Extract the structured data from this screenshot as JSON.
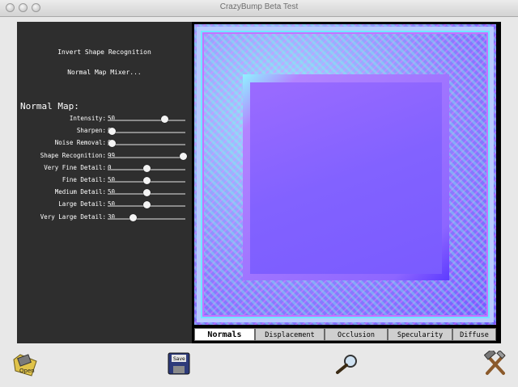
{
  "window": {
    "title": "CrazyBump Beta Test"
  },
  "panel": {
    "links": [
      "Invert Shape Recognition",
      "Normal Map Mixer..."
    ],
    "section_title": "Normal Map:",
    "sliders": [
      {
        "label": "Intensity:",
        "value": "50",
        "fraction": 0.73
      },
      {
        "label": "Sharpen:",
        "value": "0",
        "fraction": 0.06
      },
      {
        "label": "Noise Removal:",
        "value": "0",
        "fraction": 0.06
      },
      {
        "label": "Shape Recognition:",
        "value": "99",
        "fraction": 0.97
      },
      {
        "label": "Very Fine Detail:",
        "value": "0",
        "fraction": 0.5
      },
      {
        "label": "Fine Detail:",
        "value": "50",
        "fraction": 0.5
      },
      {
        "label": "Medium Detail:",
        "value": "50",
        "fraction": 0.5
      },
      {
        "label": "Large Detail:",
        "value": "50",
        "fraction": 0.5
      },
      {
        "label": "Very Large Detail:",
        "value": "30",
        "fraction": 0.33
      }
    ]
  },
  "tabs": {
    "items": [
      "Normals",
      "Displacement",
      "Occlusion",
      "Specularity",
      "Diffuse"
    ],
    "active": "Normals"
  },
  "toolbar": {
    "open_label": "Open",
    "save_label": "Save",
    "icons": [
      "open-icon",
      "save-icon",
      "magnifier-icon",
      "tools-icon"
    ]
  }
}
